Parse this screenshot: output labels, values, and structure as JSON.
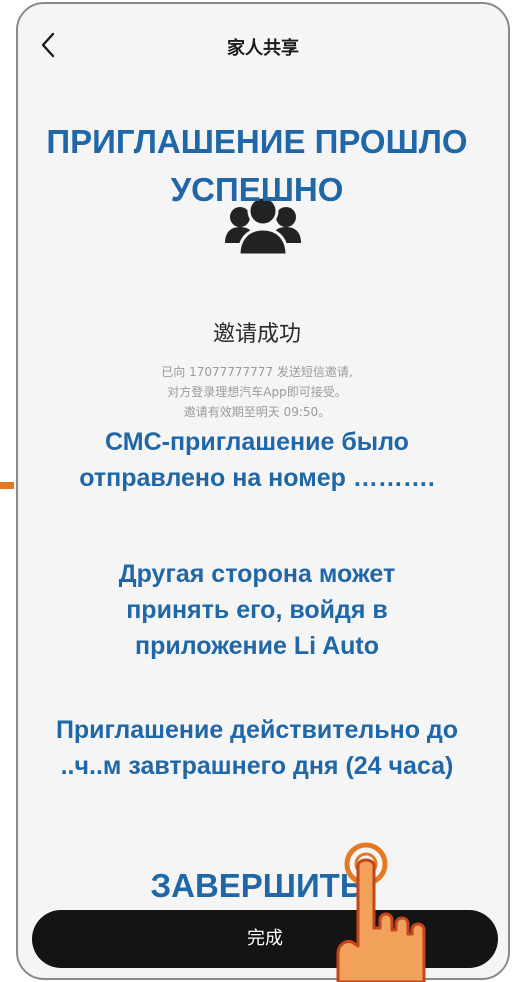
{
  "header": {
    "title": "家人共享",
    "back_icon": "chevron-left-icon"
  },
  "success": {
    "icon": "group-icon",
    "title": "邀请成功",
    "desc_line1": "已向 17077777777 发送短信邀请,",
    "desc_line2": "对方登录理想汽车App即可接受。",
    "desc_line3": "邀请有效期至明天 09:50。"
  },
  "overlay": {
    "title": "ПРИГЛАШЕНИЕ ПРОШЛО УСПЕШНО",
    "sms": "СМС-приглашение было отправлено на номер ……….",
    "other_party": "Другая сторона может принять его, войдя в приложение Li Auto",
    "validity": "Приглашение действительно до ..ч..м завтрашнего дня (24 часа)",
    "finish": "ЗАВЕРШИТЬ"
  },
  "footer": {
    "done_label": "完成",
    "hand_icon": "pointing-hand-icon"
  },
  "colors": {
    "overlay_text": "#1f67a6",
    "button_bg": "#141414",
    "screen_bg": "#f5f5f6",
    "accent_mark": "#e37a22",
    "hand_fill": "#f2a15a",
    "hand_outline": "#c4451c"
  }
}
